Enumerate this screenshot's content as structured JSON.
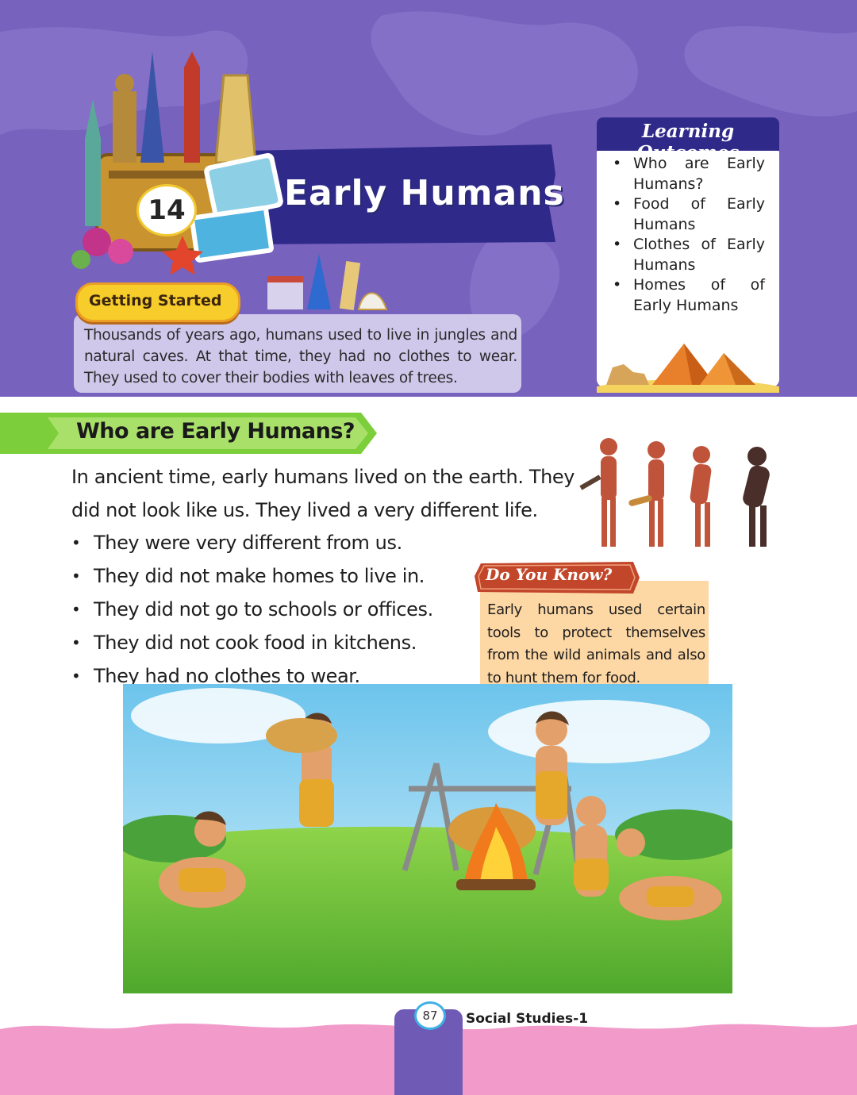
{
  "chapter": {
    "number": "14",
    "title": "Early Humans"
  },
  "getting_started": {
    "label": "Getting Started",
    "text": "Thousands of years ago, humans used to live in jungles and natural caves. At that time, they had no clothes to wear. They used to cover their bodies with leaves of trees."
  },
  "learning_outcomes": {
    "title": "Learning Outcomes",
    "items": [
      {
        "line1": "Who are Early",
        "line2": "Humans?"
      },
      {
        "line1": "Food of Early",
        "line2": "Humans"
      },
      {
        "line1": "Clothes of Early",
        "line2": "Humans"
      },
      {
        "line1": "Homes of of",
        "line2": "Early Humans"
      }
    ]
  },
  "section": {
    "title": "Who are Early Humans?",
    "intro": "In ancient time, early humans lived on the earth. They did not look like us. They lived a very different life.",
    "facts": [
      "They were very different from us.",
      "They did not make homes to live in.",
      "They did not go to schools or offices.",
      "They did not cook food in kitchens.",
      "They had no clothes to wear."
    ]
  },
  "do_you_know": {
    "title": "Do You Know?",
    "text": "Early humans used certain tools to protect themselves from the wild animals and also to hunt them for food."
  },
  "footer": {
    "page_number": "87",
    "book_title": "Social Studies-1"
  },
  "colors": {
    "header_purple": "#7762bd",
    "banner_navy": "#2f2a8a",
    "heading_green": "#7ccf3a",
    "footer_pink": "#f29bcb",
    "callout_peach": "#fdd7a4"
  },
  "icons": {
    "landmarks": "world-landmarks-illustration",
    "pyramids": "pyramids-sphinx-illustration",
    "evolution": "human-evolution-illustration",
    "scene": "early-humans-campfire-scene"
  }
}
